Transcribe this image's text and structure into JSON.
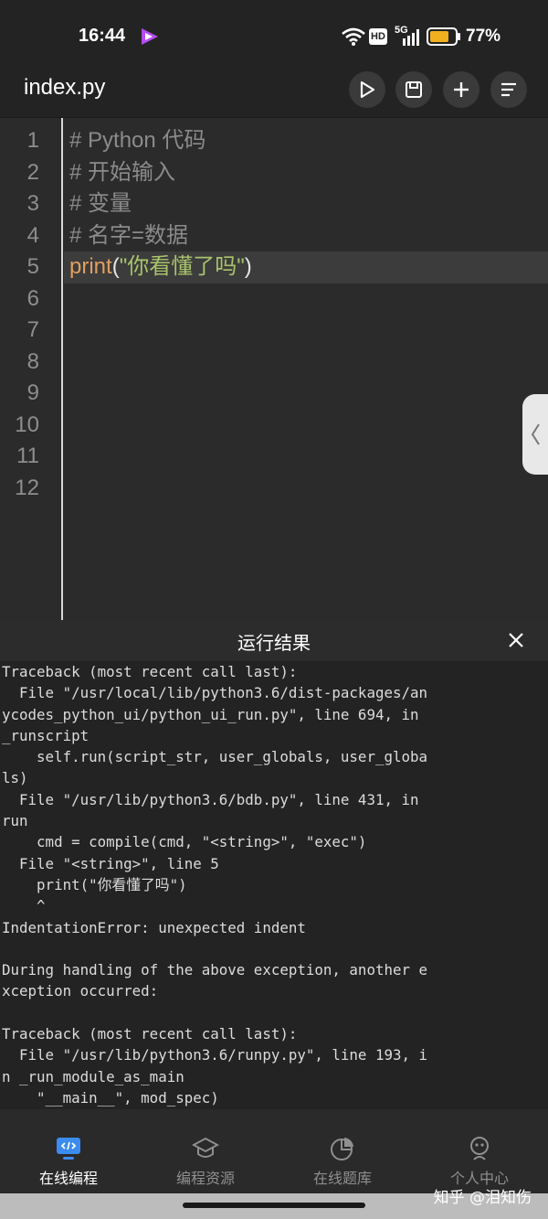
{
  "status": {
    "time": "16:44",
    "network": "5G",
    "hd": "HD",
    "battery": "77%",
    "battery_level": 0.77
  },
  "toolbar": {
    "file_name": "index.py",
    "buttons": [
      "run-icon",
      "save-icon",
      "add-icon",
      "menu-icon"
    ]
  },
  "editor": {
    "line_numbers": [
      "1",
      "2",
      "3",
      "4",
      "5",
      "6",
      "7",
      "8",
      "9",
      "10",
      "11",
      "12"
    ],
    "lines": [
      {
        "text": "# Python 代码"
      },
      {
        "text": "# 开始输入"
      },
      {
        "text": "# 变量"
      },
      {
        "text": "# 名字=数据"
      },
      {
        "kw": "print",
        "open": "(",
        "str": "\"你看懂了吗\"",
        "close": ")"
      }
    ]
  },
  "output": {
    "title": "运行结果",
    "lines": [
      "Traceback (most recent call last):",
      "  File \"/usr/local/lib/python3.6/dist-packages/an",
      "ycodes_python_ui/python_ui_run.py\", line 694, in",
      "_runscript",
      "    self.run(script_str, user_globals, user_globa",
      "ls)",
      "  File \"/usr/lib/python3.6/bdb.py\", line 431, in",
      "run",
      "    cmd = compile(cmd, \"<string>\", \"exec\")",
      "  File \"<string>\", line 5",
      "    print(\"你看懂了吗\")",
      "    ^",
      "IndentationError: unexpected indent",
      "",
      "During handling of the above exception, another e",
      "xception occurred:",
      "",
      "Traceback (most recent call last):",
      "  File \"/usr/lib/python3.6/runpy.py\", line 193, i",
      "n _run_module_as_main",
      "    \"__main__\", mod_spec)"
    ]
  },
  "nav": {
    "items": [
      {
        "label": "在线编程",
        "icon": "code-monitor-icon",
        "active": true
      },
      {
        "label": "编程资源",
        "icon": "graduation-cap-icon",
        "active": false
      },
      {
        "label": "在线题库",
        "icon": "pie-chart-icon",
        "active": false
      },
      {
        "label": "个人中心",
        "icon": "user-icon",
        "active": false
      }
    ]
  },
  "watermark": "知乎 @泪知伤",
  "colors": {
    "accent": "#3c8cf0",
    "keyword": "#e0a05e",
    "string": "#a9c46b",
    "battery": "#f2b01e"
  }
}
